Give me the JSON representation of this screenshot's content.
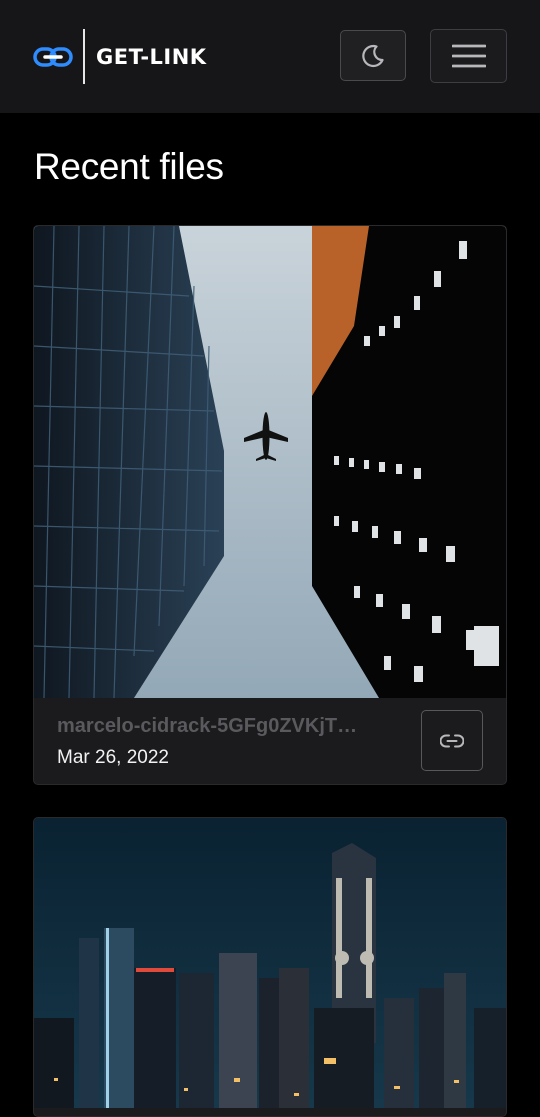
{
  "navbar": {
    "brand_name": "GET-LINK",
    "theme_toggle_icon": "moon-icon",
    "menu_icon": "hamburger-icon",
    "brand_color": "#2f8cff"
  },
  "page": {
    "title": "Recent files"
  },
  "files": [
    {
      "name": "marcelo-cidrack-5GFg0ZVKjT…",
      "date": "Mar 26, 2022",
      "image": "airplane-between-skyscrapers-photo",
      "action_icon": "link-icon"
    },
    {
      "name": "",
      "date": "",
      "image": "night-city-skyline-photo",
      "action_icon": "link-icon"
    }
  ]
}
